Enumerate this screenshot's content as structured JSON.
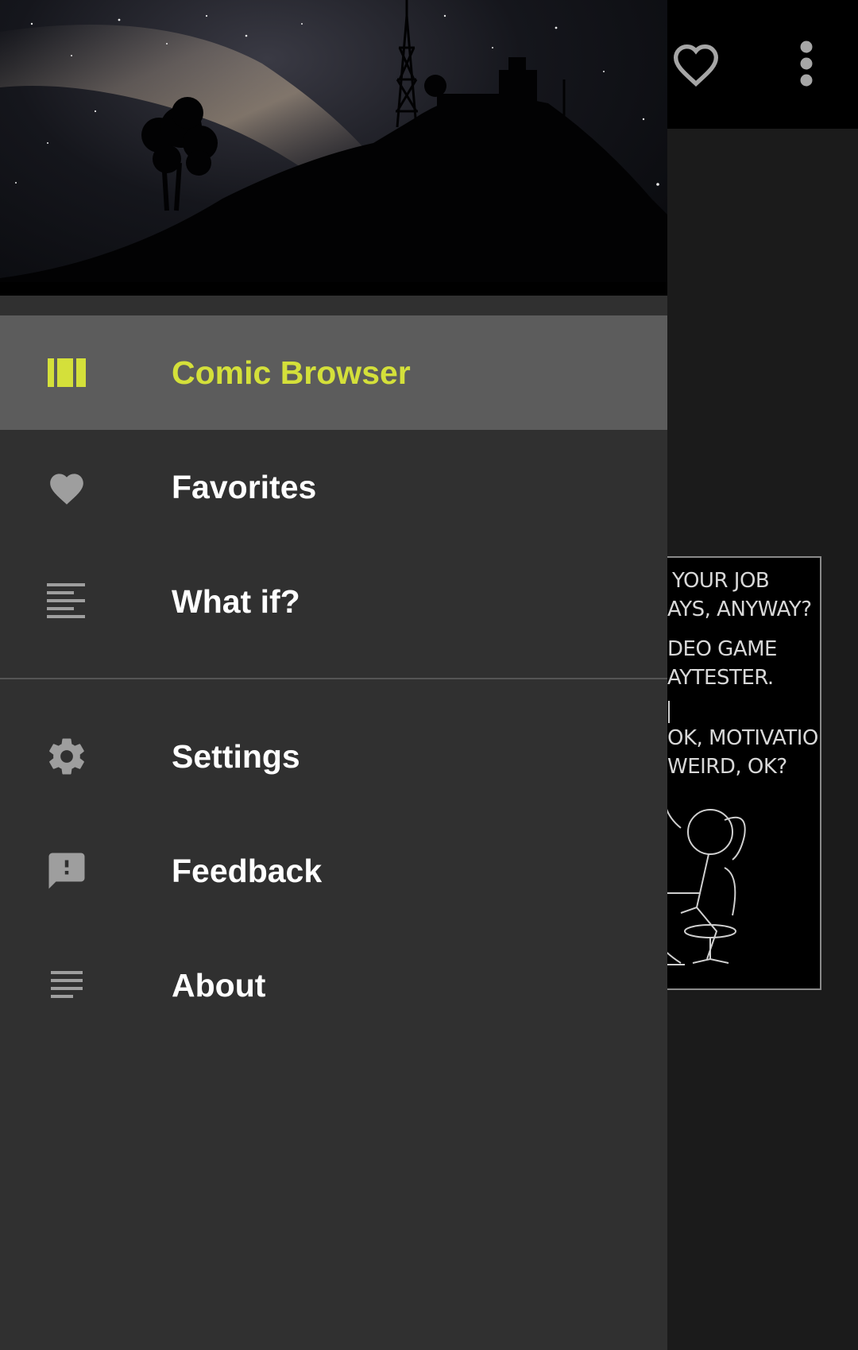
{
  "drawer": {
    "primary_items": [
      {
        "label": "Comic Browser",
        "icon": "comic-browser-icon",
        "active": true
      },
      {
        "label": "Favorites",
        "icon": "heart-icon",
        "active": false
      },
      {
        "label": "What if?",
        "icon": "article-lines-icon",
        "active": false
      }
    ],
    "secondary_items": [
      {
        "label": "Settings",
        "icon": "gear-icon"
      },
      {
        "label": "Feedback",
        "icon": "feedback-icon"
      },
      {
        "label": "About",
        "icon": "notes-icon"
      }
    ]
  },
  "appbar": {
    "actions": [
      "favorite-outline-icon",
      "more-vert-icon"
    ]
  },
  "comic": {
    "lines": [
      "YOUR JOB",
      "AYS, ANYWAY?",
      "DEO GAME",
      "AYTESTER.",
      "OK, MOTIVATION",
      "WEIRD, OK?"
    ]
  },
  "colors": {
    "accent": "#d4e03a",
    "drawer_bg": "#303030",
    "active_row": "#5c5c5c",
    "icon_gray": "#9e9e9e"
  }
}
